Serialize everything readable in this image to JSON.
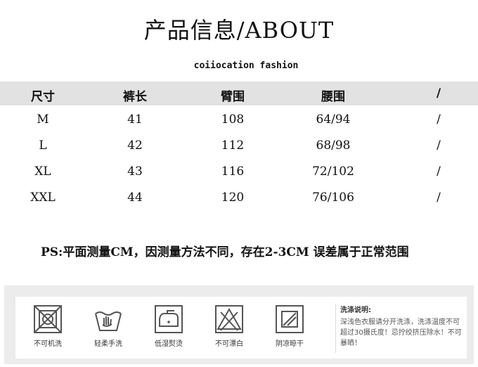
{
  "title": "产品信息/ABOUT",
  "subtitle": "coiiocation fashion",
  "table": {
    "headers": [
      "尺寸",
      "裤长",
      "臂围",
      "腰围",
      "/"
    ],
    "rows": [
      [
        "M",
        "41",
        "108",
        "64/94",
        "/"
      ],
      [
        "L",
        "42",
        "112",
        "68/98",
        "/"
      ],
      [
        "XL",
        "43",
        "116",
        "72/102",
        "/"
      ],
      [
        "XXL",
        "44",
        "120",
        "76/106",
        "/"
      ]
    ]
  },
  "note": "PS:平面测量CM，因测量方法不同，存在2-3CM 误差属于正常范围",
  "care": {
    "items": [
      {
        "label": "不可机洗",
        "icon": "no-machine-wash-icon"
      },
      {
        "label": "轻柔手洗",
        "icon": "hand-wash-icon"
      },
      {
        "label": "低湿熨烫",
        "icon": "low-iron-icon"
      },
      {
        "label": "不可漂白",
        "icon": "no-bleach-icon"
      },
      {
        "label": "阴凉晾干",
        "icon": "shade-dry-icon"
      }
    ],
    "instructions_title": "洗涤说明:",
    "instructions_body": "深浅色衣服请分开洗涤，洗涤温度不可超过30摄氏度！忌拧绞挤压除水！不可暴晒！"
  },
  "colors": {
    "header_bar": "#e2e2e2",
    "care_panel": "#ececec",
    "icon_stroke": "#555555"
  }
}
